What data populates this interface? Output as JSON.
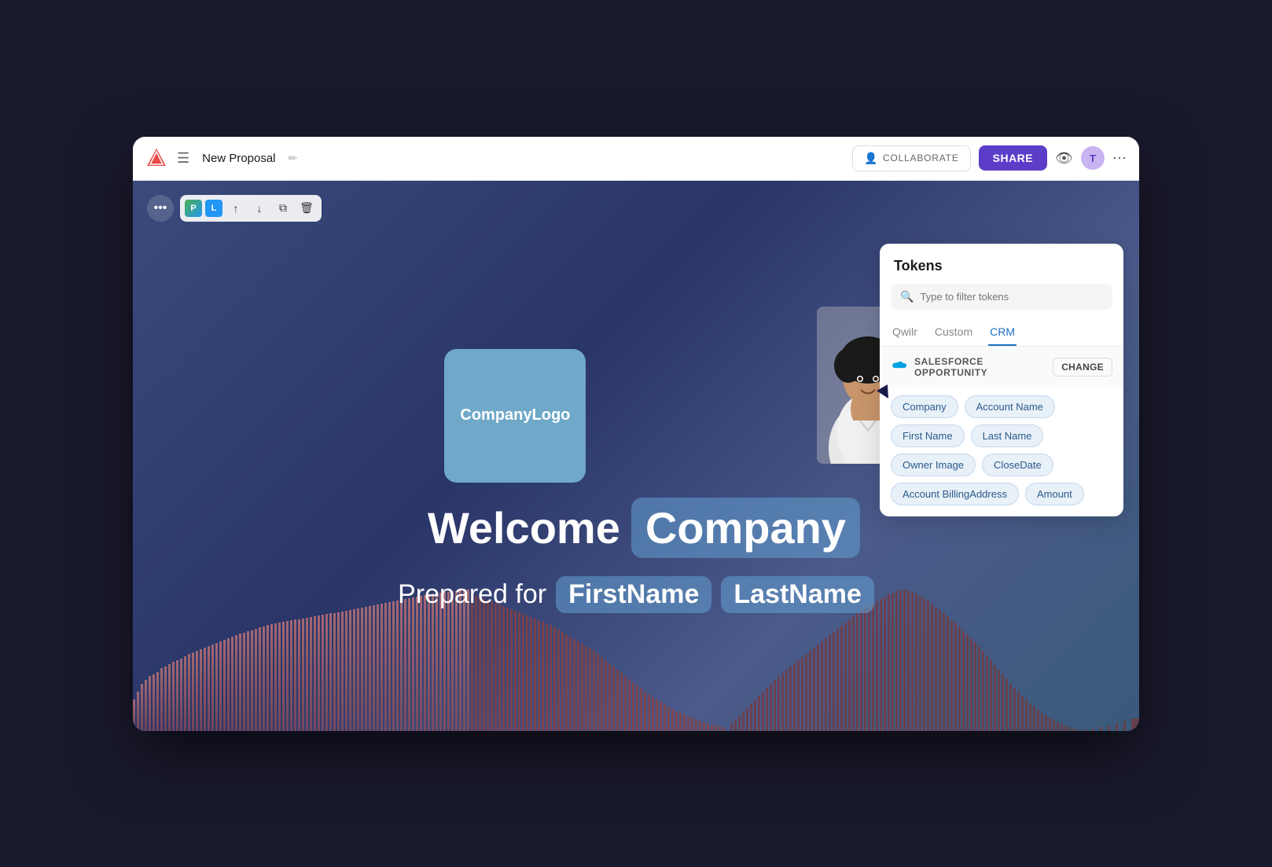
{
  "topbar": {
    "doc_title": "New Proposal",
    "collaborate_label": "COLLABORATE",
    "share_label": "SHARE",
    "avatar_initials": "T",
    "more_label": "···"
  },
  "toolbar": {
    "dots_label": "•••",
    "p_label": "P",
    "l_label": "L",
    "up_label": "↑",
    "down_label": "↓",
    "copy_label": "⧉",
    "delete_label": "🗑"
  },
  "canvas": {
    "logo_text": "CompanyLogo",
    "welcome_text": "Welcome",
    "company_token": "Company",
    "prepared_text": "Prepared for",
    "firstname_token": "FirstName",
    "lastname_token": "LastName"
  },
  "tokens_panel": {
    "title": "Tokens",
    "search_placeholder": "Type to filter tokens",
    "tabs": [
      {
        "id": "qwilr",
        "label": "Qwilr",
        "active": false
      },
      {
        "id": "custom",
        "label": "Custom",
        "active": false
      },
      {
        "id": "crm",
        "label": "CRM",
        "active": true
      }
    ],
    "salesforce_label": "SALESFORCE OPPORTUNITY",
    "change_label": "CHANGE",
    "tokens": [
      "Company",
      "Account Name",
      "First Name",
      "Last Name",
      "Owner Image",
      "CloseDate",
      "Account BillingAddress",
      "Amount"
    ]
  }
}
